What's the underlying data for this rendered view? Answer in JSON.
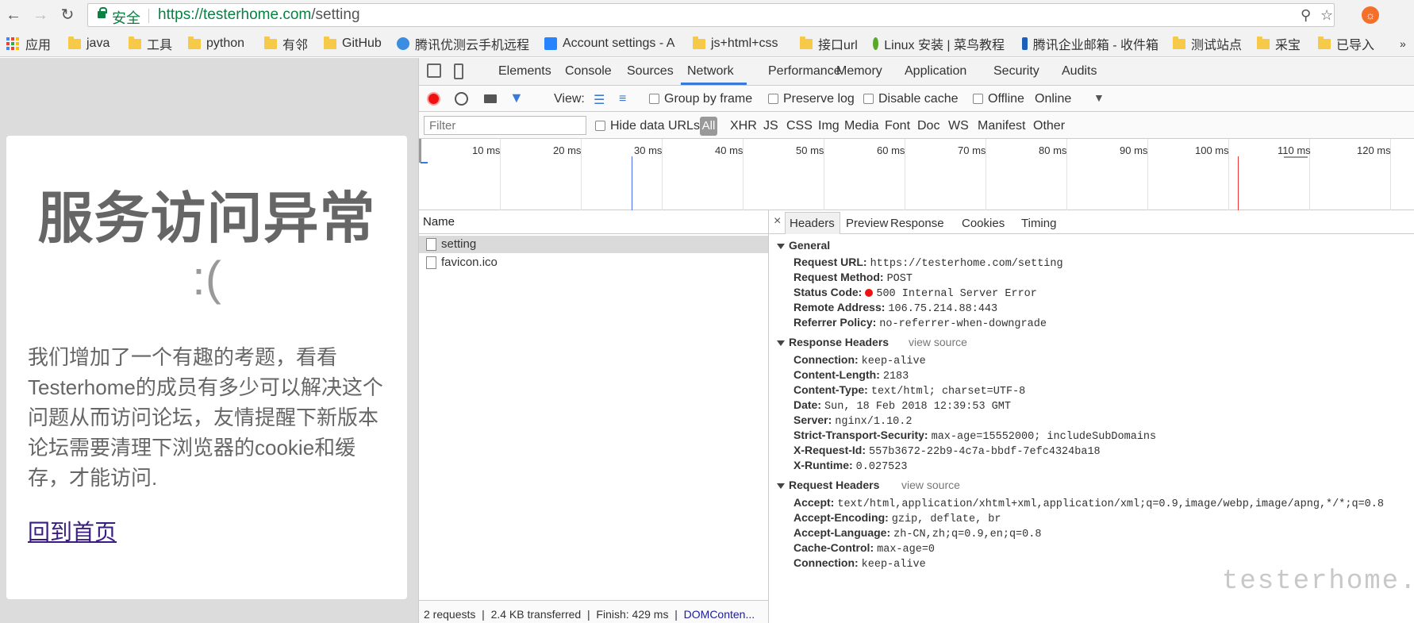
{
  "browser": {
    "security_label": "安全",
    "url_scheme_host": "https://testerhome.com",
    "url_path": "/setting",
    "extension_icon": "orange-circle-icon"
  },
  "bookmarks": [
    {
      "label": "应用",
      "icon": "apps-grid-icon"
    },
    {
      "label": "java",
      "icon": "folder-icon"
    },
    {
      "label": "工具",
      "icon": "folder-icon"
    },
    {
      "label": "python",
      "icon": "folder-icon"
    },
    {
      "label": "有邻",
      "icon": "folder-icon"
    },
    {
      "label": "GitHub",
      "icon": "folder-icon"
    },
    {
      "label": "腾讯优测云手机远程",
      "icon": "tencent-icon"
    },
    {
      "label": "Account settings - A",
      "icon": "atlassian-icon"
    },
    {
      "label": "js+html+css",
      "icon": "folder-icon"
    },
    {
      "label": "接口url",
      "icon": "folder-icon"
    },
    {
      "label": "Linux 安装 | 菜鸟教程",
      "icon": "runoob-icon"
    },
    {
      "label": "腾讯企业邮箱 - 收件箱",
      "icon": "exmail-icon"
    },
    {
      "label": "测试站点",
      "icon": "folder-icon"
    },
    {
      "label": "采宝",
      "icon": "folder-icon"
    },
    {
      "label": "已导入",
      "icon": "folder-icon"
    }
  ],
  "error_page": {
    "title": "服务访问异常",
    "face": ":(",
    "message": "我们增加了一个有趣的考题，看看Testerhome的成员有多少可以解决这个问题从而访问论坛，友情提醒下新版本论坛需要清理下浏览器的cookie和缓存，才能访问.",
    "home_link": "回到首页"
  },
  "devtools": {
    "tabs": [
      "Elements",
      "Console",
      "Sources",
      "Network",
      "Performance",
      "Memory",
      "Application",
      "Security",
      "Audits"
    ],
    "active_tab": "Network",
    "view_label": "View:",
    "group_by_frame": "Group by frame",
    "preserve_log": "Preserve log",
    "disable_cache": "Disable cache",
    "offline": "Offline",
    "throttle": "Online",
    "filter_placeholder": "Filter",
    "hide_data_urls": "Hide data URLs",
    "filter_types": [
      "All",
      "XHR",
      "JS",
      "CSS",
      "Img",
      "Media",
      "Font",
      "Doc",
      "WS",
      "Manifest",
      "Other"
    ],
    "timeline_ticks": [
      "10 ms",
      "20 ms",
      "30 ms",
      "40 ms",
      "50 ms",
      "60 ms",
      "70 ms",
      "80 ms",
      "90 ms",
      "100 ms",
      "110 ms",
      "120 ms"
    ],
    "name_header": "Name",
    "requests": [
      "setting",
      "favicon.ico"
    ],
    "status": {
      "requests": "2 requests",
      "transferred": "2.4 KB transferred",
      "finish": "Finish: 429 ms",
      "dom": "DOMConten..."
    },
    "detail_tabs": [
      "Headers",
      "Preview",
      "Response",
      "Cookies",
      "Timing"
    ],
    "general": {
      "title": "General",
      "rows": [
        {
          "k": "Request URL:",
          "v": "https://testerhome.com/setting"
        },
        {
          "k": "Request Method:",
          "v": "POST"
        },
        {
          "k": "Status Code:",
          "v": "500 Internal Server Error"
        },
        {
          "k": "Remote Address:",
          "v": "106.75.214.88:443"
        },
        {
          "k": "Referrer Policy:",
          "v": "no-referrer-when-downgrade"
        }
      ]
    },
    "response_headers": {
      "title": "Response Headers",
      "view_source": "view source",
      "rows": [
        {
          "k": "Connection:",
          "v": "keep-alive"
        },
        {
          "k": "Content-Length:",
          "v": "2183"
        },
        {
          "k": "Content-Type:",
          "v": "text/html; charset=UTF-8"
        },
        {
          "k": "Date:",
          "v": "Sun, 18 Feb 2018 12:39:53 GMT"
        },
        {
          "k": "Server:",
          "v": "nginx/1.10.2"
        },
        {
          "k": "Strict-Transport-Security:",
          "v": "max-age=15552000; includeSubDomains"
        },
        {
          "k": "X-Request-Id:",
          "v": "557b3672-22b9-4c7a-bbdf-7efc4324ba18"
        },
        {
          "k": "X-Runtime:",
          "v": "0.027523"
        }
      ]
    },
    "request_headers": {
      "title": "Request Headers",
      "view_source": "view source",
      "rows": [
        {
          "k": "Accept:",
          "v": "text/html,application/xhtml+xml,application/xml;q=0.9,image/webp,image/apng,*/*;q=0.8"
        },
        {
          "k": "Accept-Encoding:",
          "v": "gzip, deflate, br"
        },
        {
          "k": "Accept-Language:",
          "v": "zh-CN,zh;q=0.9,en;q=0.8"
        },
        {
          "k": "Cache-Control:",
          "v": "max-age=0"
        },
        {
          "k": "Connection:",
          "v": "keep-alive"
        }
      ]
    },
    "watermark": "testerhome.com"
  }
}
